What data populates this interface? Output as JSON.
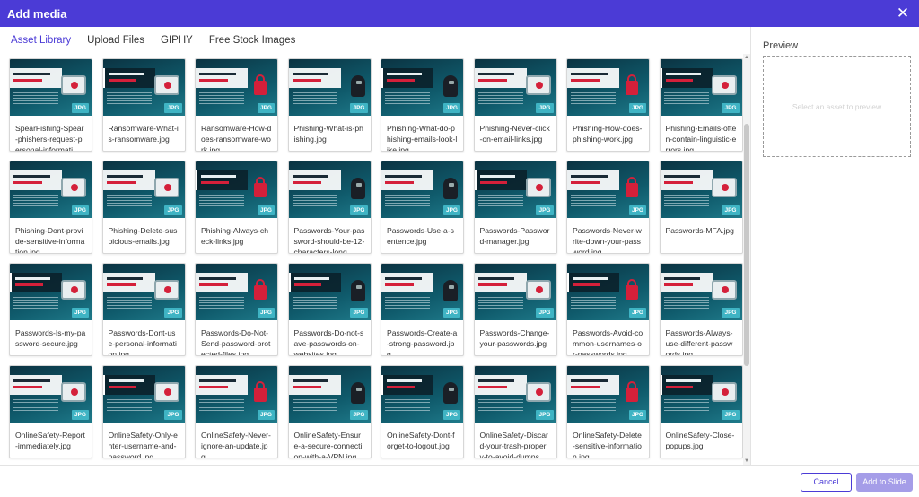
{
  "dialog": {
    "title": "Add media",
    "close_icon": "close-icon"
  },
  "tabs": [
    {
      "label": "Asset Library",
      "active": true
    },
    {
      "label": "Upload Files",
      "active": false
    },
    {
      "label": "GIPHY",
      "active": false
    },
    {
      "label": "Free Stock Images",
      "active": false
    }
  ],
  "badge_label": "JPG",
  "assets": [
    "SpearFishing-Spear-phishers-request-personal-informati",
    "Ransomware-What-is-ransomware.jpg",
    "Ransomware-How-does-ransomware-work.jpg",
    "Phishing-What-is-phishing.jpg",
    "Phishing-What-do-phishing-emails-look-like.jpg",
    "Phishing-Never-click-on-email-links.jpg",
    "Phishing-How-does-phishing-work.jpg",
    "Phishing-Emails-often-contain-linguistic-errors.jpg",
    "Phishing-Dont-provide-sensitive-information.jpg",
    "Phishing-Delete-suspicious-emails.jpg",
    "Phishing-Always-check-links.jpg",
    "Passwords-Your-password-should-be-12-characters-long",
    "Passwords-Use-a-sentence.jpg",
    "Passwords-Password-manager.jpg",
    "Passwords-Never-write-down-your-password.jpg",
    "Passwords-MFA.jpg",
    "Passwords-Is-my-password-secure.jpg",
    "Passwords-Dont-use-personal-information.jpg",
    "Passwords-Do-Not-Send-password-protected-files.jpg",
    "Passwords-Do-not-save-passwords-on-websites.jpg",
    "Passwords-Create-a-strong-password.jpg",
    "Passwords-Change-your-passwords.jpg",
    "Passwords-Avoid-common-usernames-or-passwords.jpg",
    "Passwords-Always-use-different-passwords.jpg",
    "OnlineSafety-Report-immediately.jpg",
    "OnlineSafety-Only-enter-username-and-password.jpg",
    "OnlineSafety-Never-ignore-an-update.jpg",
    "OnlineSafety-Ensure-a-secure-connection-with-a-VPN.jpg",
    "OnlineSafety-Dont-forget-to-logout.jpg",
    "OnlineSafety-Discard-your-trash-properly-to-avoid-dumps",
    "OnlineSafety-Delete-sensitive-information.jpg",
    "OnlineSafety-Close-popups.jpg"
  ],
  "preview": {
    "title": "Preview",
    "hint": "Select an asset to preview"
  },
  "footer": {
    "cancel_label": "Cancel",
    "add_label": "Add to Slide"
  }
}
